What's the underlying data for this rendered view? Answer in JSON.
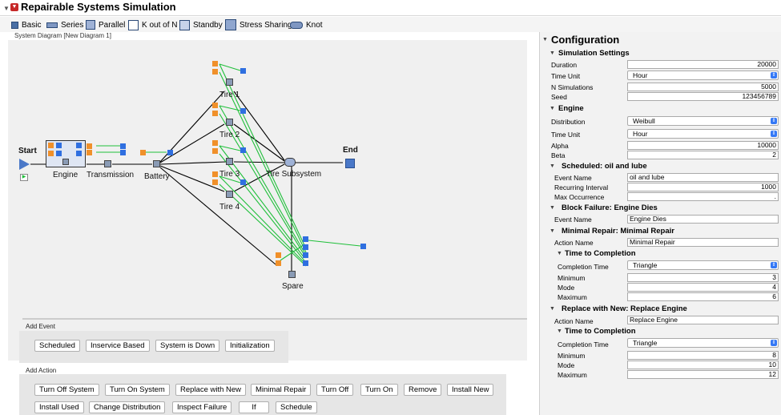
{
  "app": {
    "title": "Repairable Systems Simulation"
  },
  "toolbar": {
    "basic": "Basic",
    "series": "Series",
    "parallel": "Parallel",
    "kofn": "K out of N",
    "standby": "Standby",
    "stress": "Stress Sharing",
    "knot": "Knot"
  },
  "diagram": {
    "title": "System Diagram [New Diagram 1]",
    "nodes": {
      "start": "Start",
      "engine": "Engine",
      "transmission": "Transmission",
      "battery": "Battery",
      "tire1": "Tire 1",
      "tire2": "Tire 2",
      "tire3": "Tire 3",
      "tire4": "Tire 4",
      "tire_subsystem": "Tire Subsystem",
      "end": "End",
      "spare": "Spare"
    }
  },
  "events": {
    "title": "Add Event",
    "buttons": [
      "Scheduled",
      "Inservice Based",
      "System is Down",
      "Initialization"
    ]
  },
  "actions": {
    "title": "Add Action",
    "buttons": [
      "Turn Off System",
      "Turn On System",
      "Replace with New",
      "Minimal Repair",
      "Turn Off",
      "Turn On",
      "Remove",
      "Install New",
      "Install Used",
      "Change Distribution",
      "Inspect Failure",
      "If",
      "Schedule"
    ]
  },
  "config": {
    "title": "Configuration",
    "sim": {
      "header": "Simulation Settings",
      "duration_label": "Duration",
      "duration": "20000",
      "time_unit_label": "Time Unit",
      "time_unit": "Hour",
      "nsim_label": "N Simulations",
      "nsim": "5000",
      "seed_label": "Seed",
      "seed": "123456789"
    },
    "engine": {
      "header": "Engine",
      "dist_label": "Distribution",
      "dist": "Weibull",
      "time_unit_label": "Time Unit",
      "time_unit": "Hour",
      "alpha_label": "Alpha",
      "alpha": "10000",
      "beta_label": "Beta",
      "beta": "2"
    },
    "scheduled": {
      "header": "Scheduled: oil and lube",
      "event_name_label": "Event Name",
      "event_name": "oil and lube",
      "interval_label": "Recurring Interval",
      "interval": "1000",
      "max_label": "Max Occurrence",
      "max": "."
    },
    "block_failure": {
      "header": "Block Failure: Engine Dies",
      "event_name_label": "Event Name",
      "event_name": "Engine Dies"
    },
    "minimal_repair": {
      "header": "Minimal Repair: Minimal Repair",
      "action_name_label": "Action Name",
      "action_name": "Minimal Repair",
      "ttc_header": "Time to Completion",
      "ct_label": "Completion Time",
      "ct": "Triangle",
      "min_label": "Minimum",
      "min": "3",
      "mode_label": "Mode",
      "mode": "4",
      "max_label": "Maximum",
      "max": "6"
    },
    "replace": {
      "header": "Replace with New: Replace Engine",
      "action_name_label": "Action Name",
      "action_name": "Replace Engine",
      "ttc_header": "Time to Completion",
      "ct_label": "Completion Time",
      "ct": "Triangle",
      "min_label": "Minimum",
      "min": "8",
      "mode_label": "Mode",
      "mode": "10",
      "max_label": "Maximum",
      "max": "12"
    }
  }
}
